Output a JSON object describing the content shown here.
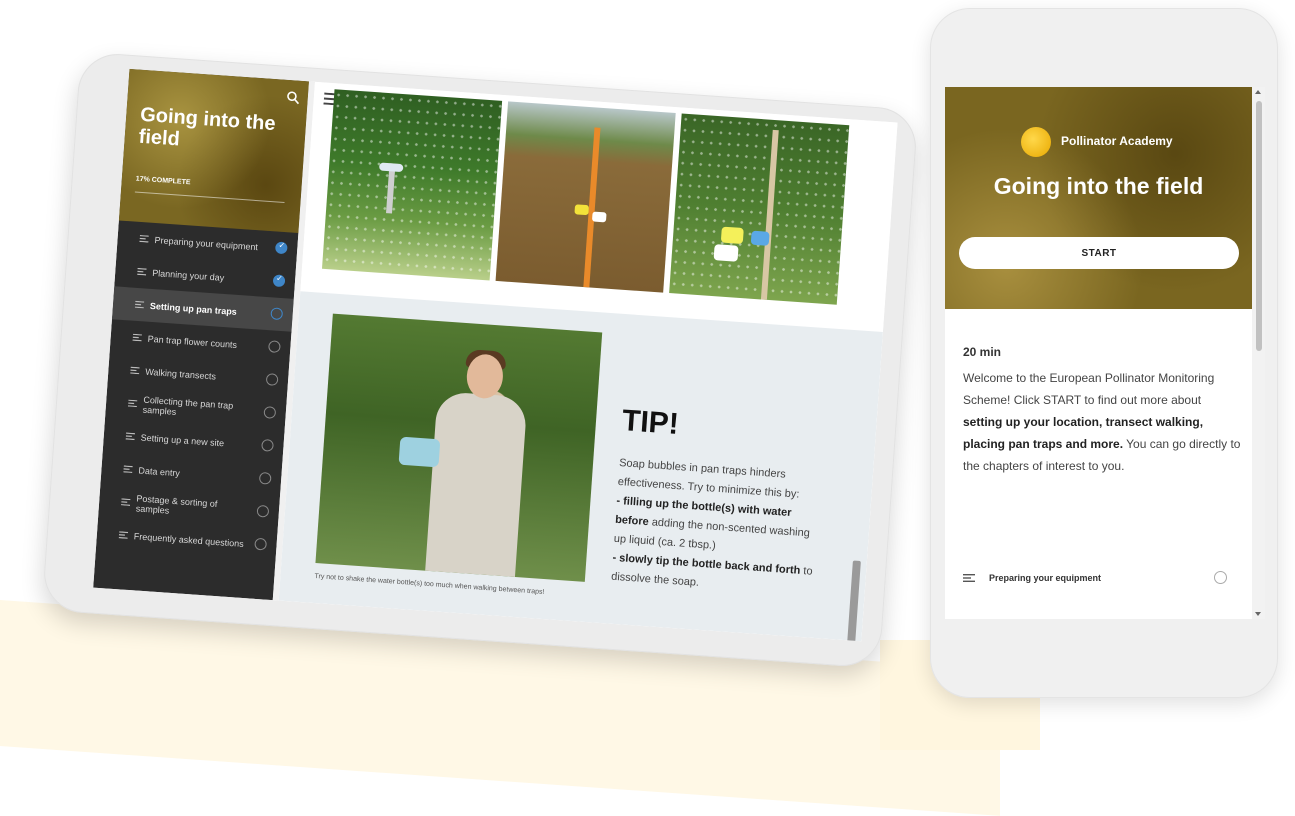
{
  "tablet": {
    "course_title": "Going into the field",
    "progress_label": "17% COMPLETE",
    "progress_percent": 17,
    "lessons": [
      {
        "label": "Preparing your equipment",
        "status": "done"
      },
      {
        "label": "Planning your day",
        "status": "done"
      },
      {
        "label": "Setting up pan traps",
        "status": "current"
      },
      {
        "label": "Pan trap flower counts",
        "status": "todo"
      },
      {
        "label": "Walking transects",
        "status": "todo"
      },
      {
        "label": "Collecting the pan trap samples",
        "status": "todo"
      },
      {
        "label": "Setting up a new site",
        "status": "todo"
      },
      {
        "label": "Data entry",
        "status": "todo"
      },
      {
        "label": "Postage & sorting of samples",
        "status": "todo"
      },
      {
        "label": "Frequently asked questions",
        "status": "todo"
      }
    ],
    "tip": {
      "title": "TIP!",
      "text_1": "Soap bubbles in pan traps hinders effectiveness. Try to minimize this by:",
      "bullet_1_bold": "- filling up the bottle(s) with water before",
      "bullet_1_rest": " adding the non-scented washing up liquid (ca. 2 tbsp.)",
      "bullet_2_bold": "- slowly tip the bottle back and forth",
      "bullet_2_rest": " to dissolve the soap.",
      "photo_caption": "Try not to shake the water bottle(s) too much when walking between traps!"
    }
  },
  "phone": {
    "brand": "Pollinator Academy",
    "course_title": "Going into the field",
    "start_label": "START",
    "duration": "20 min",
    "desc_plain_1": "Welcome to the European Pollinator Monitoring Scheme! Click START to find out more about ",
    "desc_bold": "setting up your location, transect walking, placing pan traps and more.",
    "desc_plain_2": " You can go directly to the chapters of interest to you.",
    "first_chapter": "Preparing your equipment"
  },
  "colors": {
    "hero_olive": "#7a6620",
    "sidebar_dark": "#2c2c2c",
    "check_blue": "#3f86c8",
    "tip_panel": "#e8edf0"
  }
}
